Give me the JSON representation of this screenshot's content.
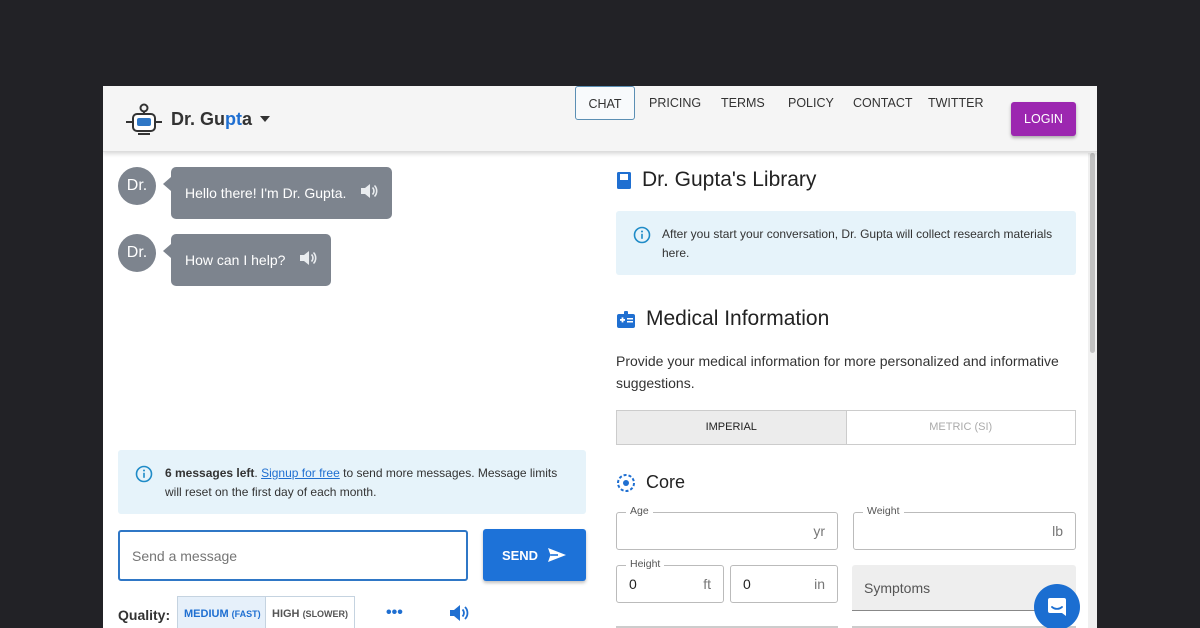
{
  "brand": {
    "prefix": "Dr.",
    "name_g": "G",
    "name_u": "u",
    "name_p": "p",
    "name_t": "t",
    "name_a": "a"
  },
  "nav": {
    "items": [
      "CHAT",
      "PRICING",
      "TERMS",
      "POLICY",
      "CONTACT",
      "TWITTER"
    ],
    "active": "CHAT",
    "login": "LOGIN"
  },
  "chat": {
    "messages": [
      {
        "sender": "Dr.",
        "text": "Hello there! I'm Dr. Gupta."
      },
      {
        "sender": "Dr.",
        "text": "How can I help?"
      }
    ],
    "limit_notice": {
      "count": "6 messages left",
      "link": "Signup for free",
      "rest": "to send more messages. Message limits will reset on the first day of each month."
    },
    "input_placeholder": "Send a message",
    "send_label": "SEND",
    "quality_label": "Quality:",
    "quality_options": [
      {
        "label": "MEDIUM",
        "sub": "(FAST)",
        "selected": true
      },
      {
        "label": "HIGH",
        "sub": "(SLOWER)",
        "selected": false
      }
    ],
    "more": "•••"
  },
  "library": {
    "title": "Dr. Gupta's Library",
    "notice": "After you start your conversation, Dr. Gupta will collect research materials here."
  },
  "medical": {
    "title": "Medical Information",
    "description": "Provide your medical information for more personalized and informative suggestions.",
    "units": [
      "IMPERIAL",
      "METRIC (SI)"
    ],
    "selected_unit": "IMPERIAL",
    "core_title": "Core",
    "fields": {
      "age": {
        "label": "Age",
        "value": "",
        "unit": "yr"
      },
      "weight": {
        "label": "Weight",
        "value": "",
        "unit": "lb"
      },
      "height_ft": {
        "label": "Height",
        "value": "0",
        "unit": "ft"
      },
      "height_in": {
        "value": "0",
        "unit": "in"
      },
      "symptoms": {
        "placeholder": "Symptoms"
      }
    }
  },
  "colors": {
    "accent": "#1f6fd1",
    "login": "#9c27b0",
    "bubble": "#7d848e",
    "notice_bg": "#e6f3fa"
  }
}
